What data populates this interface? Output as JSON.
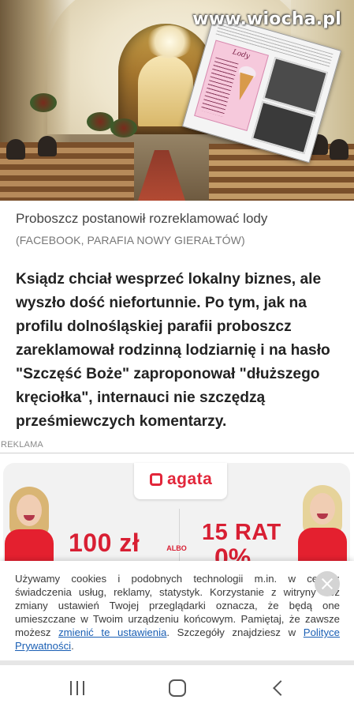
{
  "hero": {
    "watermark": "www.wiocha.pl",
    "overlay_poster_title": "Lody"
  },
  "article": {
    "caption": "Proboszcz postanowił rozreklamować lody",
    "source": "(FACEBOOK, PARAFIA NOWY GIERAŁTÓW)",
    "lead": "Ksiądz chciał wesprzeć lokalny biznes, ale wyszło dość niefortunnie. Po tym, jak na profilu dolnośląskiej parafii proboszcz zareklamował rodzinną lodziarnię i na hasło \"Szczęść Boże\" zaproponował \"dłuższego kręciołka\", internauci nie szczędzą prześmiewczych komentarzy."
  },
  "ad": {
    "label": "REKLAMA",
    "brand": "agata",
    "price_left": "100 zł",
    "albo": "ALBO",
    "price_right": "15 RAT",
    "percent": "0%",
    "brand_color": "#e2263a"
  },
  "cookie": {
    "text_before_link1": "Używamy cookies i podobnych technologii m.in. w celach: świadczenia usług, reklamy, statystyk. Korzystanie z witryny bez zmiany ustawień Twojej przeglądarki oznacza, że będą one umieszczane w Twoim urządzeniu końcowym. Pamiętaj, że zawsze możesz ",
    "link1": "zmienić te ustawienia",
    "text_between": ". Szczegóły znajdziesz w ",
    "link2": "Polityce Prywatności",
    "text_after": ".",
    "close_icon": "close-icon",
    "link_color": "#1a5fb4"
  },
  "navbar": {
    "icons": [
      "recents-icon",
      "home-icon",
      "back-icon"
    ]
  }
}
